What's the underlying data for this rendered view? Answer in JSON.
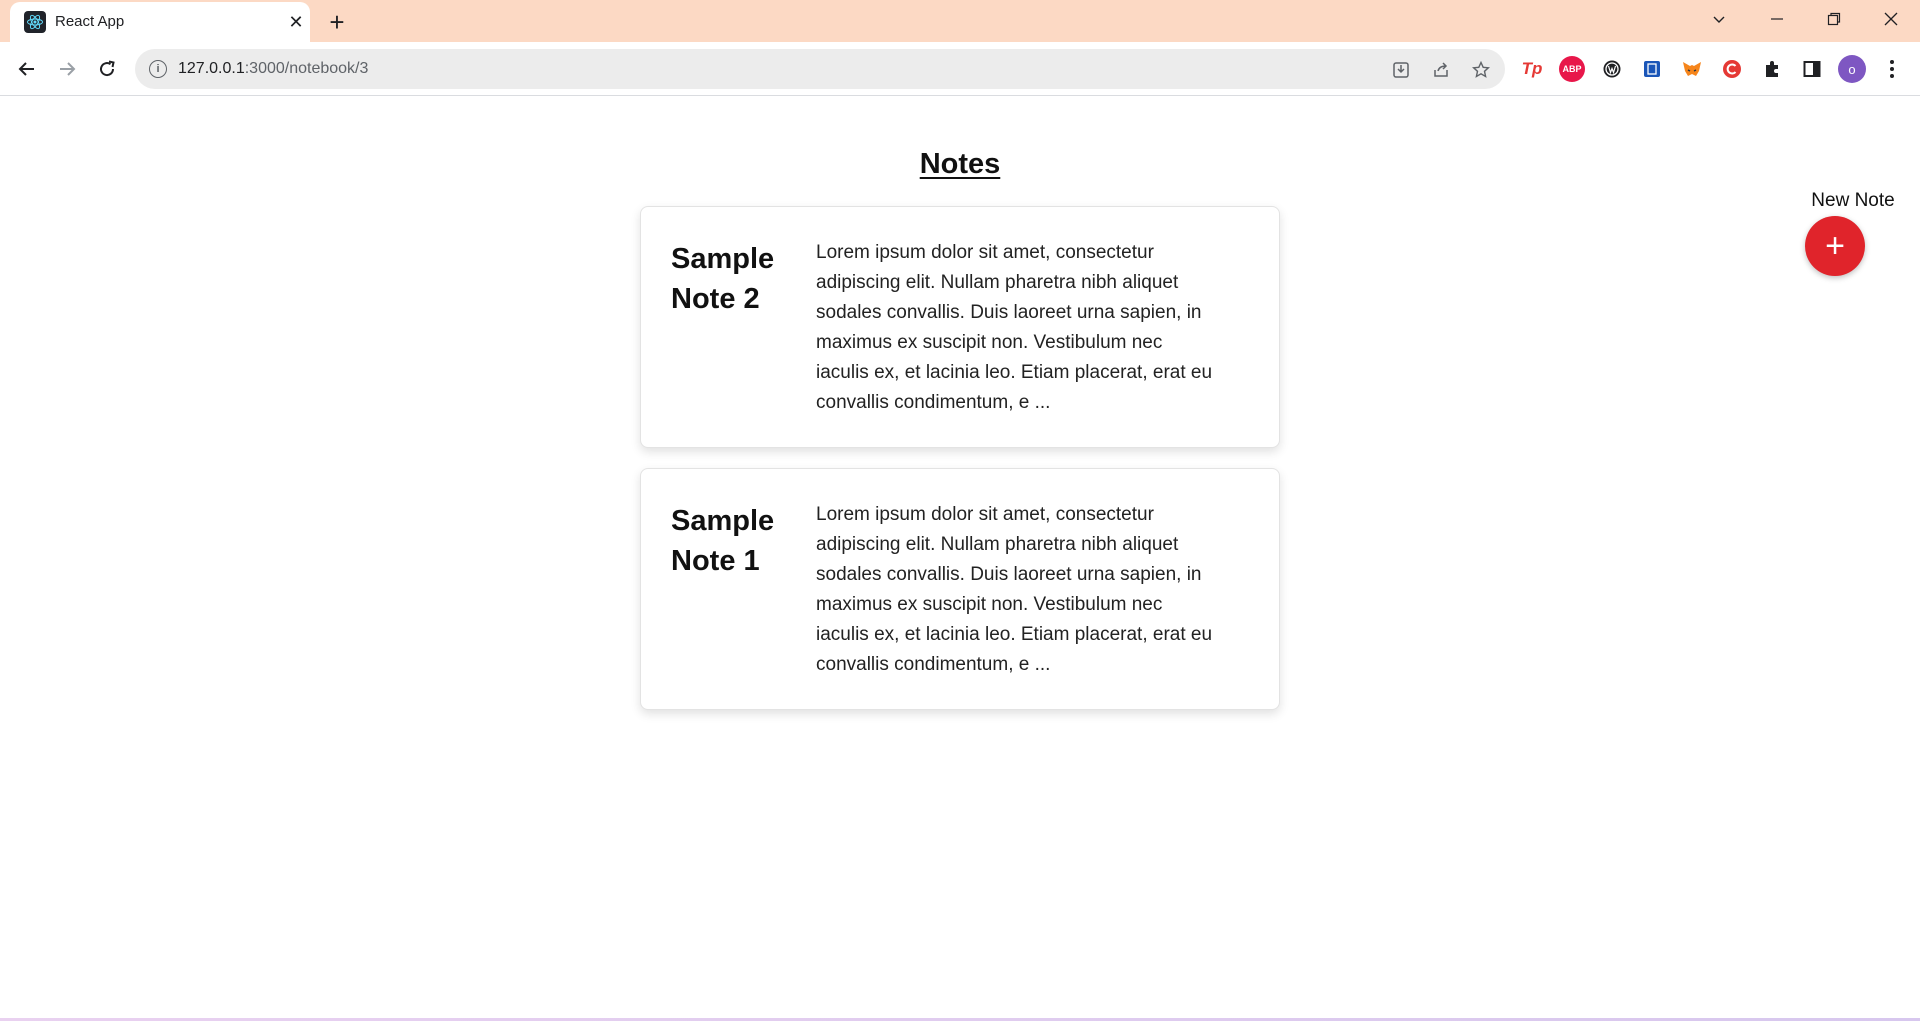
{
  "browser": {
    "tab_title": "React App",
    "tab_close": "✕",
    "new_tab": "+",
    "url_host": "127.0.0.1",
    "url_path": ":3000/notebook/3",
    "omni_info": "i",
    "extensions": [
      "Tp",
      "ABP",
      "",
      "",
      "",
      "",
      ""
    ],
    "avatar_letter": "o",
    "colors": {
      "tab_bar": "#fcd9c4",
      "omnibox": "#ececec"
    }
  },
  "page": {
    "title": "Notes",
    "new_note_label": "New Note",
    "fab_symbol": "+",
    "accent_color": "#e0242b"
  },
  "notes": [
    {
      "title": "Sample Note 2",
      "preview": "Lorem ipsum dolor sit amet, consectetur adipiscing elit. Nullam pharetra nibh aliquet sodales convallis. Duis laoreet urna sapien, in maximus ex suscipit non. Vestibulum nec iaculis ex, et lacinia leo. Etiam placerat, erat eu convallis condimentum, e ..."
    },
    {
      "title": "Sample Note 1",
      "preview": "Lorem ipsum dolor sit amet, consectetur adipiscing elit. Nullam pharetra nibh aliquet sodales convallis. Duis laoreet urna sapien, in maximus ex suscipit non. Vestibulum nec iaculis ex, et lacinia leo. Etiam placerat, erat eu convallis condimentum, e ..."
    }
  ]
}
